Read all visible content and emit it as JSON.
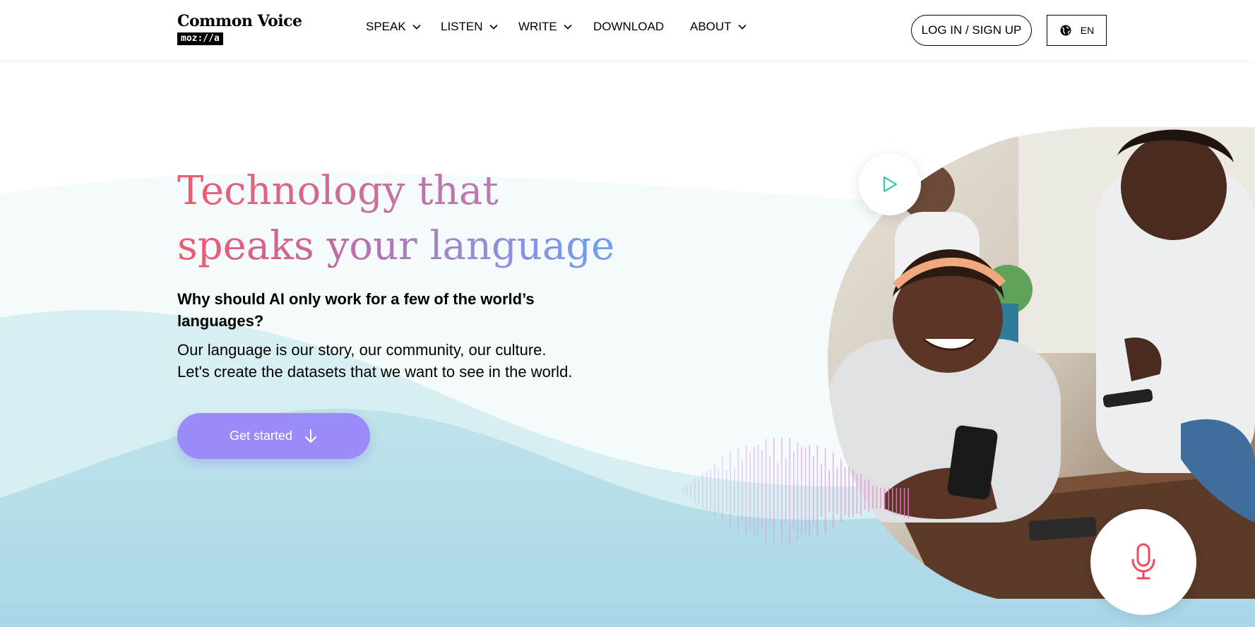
{
  "header": {
    "logo_title": "Common Voice",
    "logo_badge": "moz://a",
    "nav": [
      {
        "label": "SPEAK",
        "has_dropdown": true
      },
      {
        "label": "LISTEN",
        "has_dropdown": true
      },
      {
        "label": "WRITE",
        "has_dropdown": true
      },
      {
        "label": "DOWNLOAD",
        "has_dropdown": false
      },
      {
        "label": "ABOUT",
        "has_dropdown": true
      }
    ],
    "login_label": "LOG IN / SIGN UP",
    "language": "EN",
    "language_icon": "globe-icon"
  },
  "hero": {
    "title_line1": "Technology that",
    "title_line2": "speaks your language",
    "question_line1": "Why should AI only work for a few of the world’s",
    "question_line2": "languages?",
    "paragraph_line1": "Our language is our story, our community, our culture.",
    "paragraph_line2": "Let's create the datasets that we want to see in the world.",
    "cta_label": "Get started",
    "cta_icon": "arrow-down-icon"
  },
  "colors": {
    "cta": "#9a8cf8",
    "title_gradient_start": "#ef5b6e",
    "title_gradient_end": "#6e9ef0",
    "play_icon": "#3ec9a7",
    "mic_icon": "#f1495c"
  },
  "media": {
    "play_icon": "play-icon",
    "mic_icon": "microphone-icon"
  }
}
